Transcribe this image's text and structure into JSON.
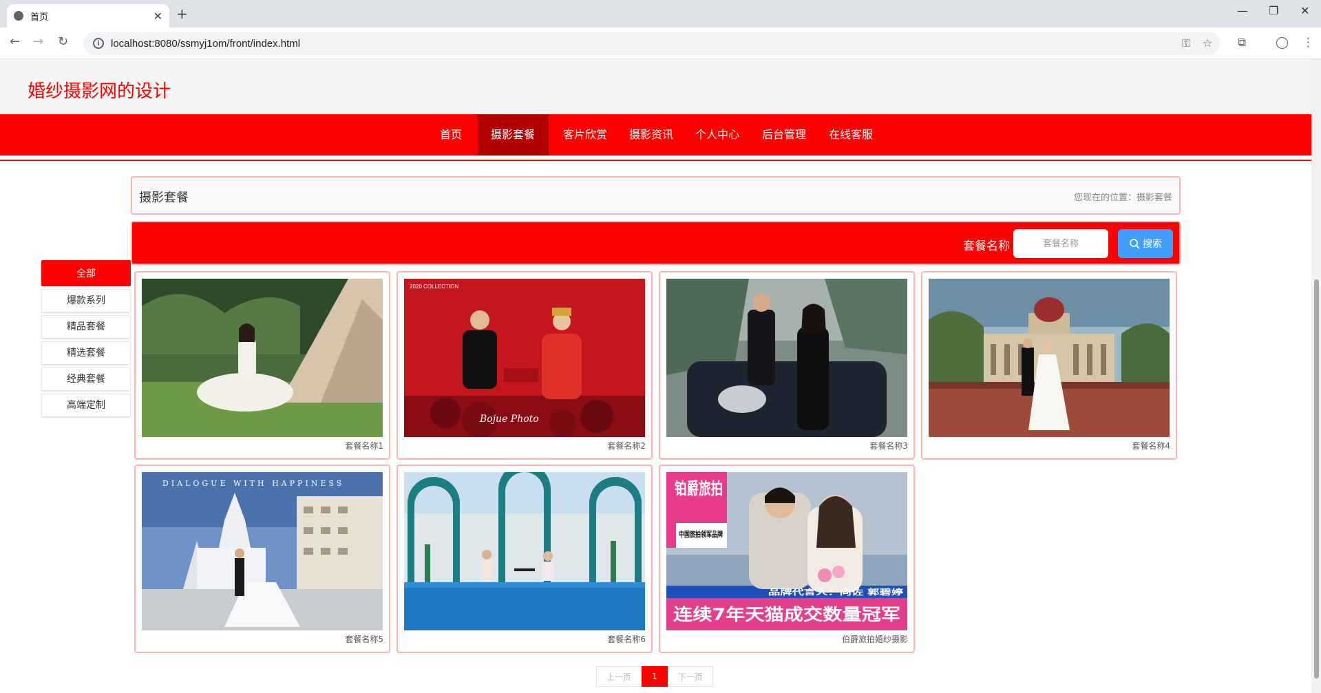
{
  "browser": {
    "tab_title": "首页",
    "url": "localhost:8080/ssmyj1om/front/index.html"
  },
  "site": {
    "title": "婚纱摄影网的设计"
  },
  "nav": {
    "items": [
      {
        "label": "首页"
      },
      {
        "label": "摄影套餐"
      },
      {
        "label": "客片欣赏"
      },
      {
        "label": "摄影资讯"
      },
      {
        "label": "个人中心"
      },
      {
        "label": "后台管理"
      },
      {
        "label": "在线客服"
      }
    ],
    "active": "摄影套餐"
  },
  "breadcrumb": {
    "heading": "摄影套餐",
    "location": "您现在的位置：摄影套餐"
  },
  "search": {
    "label": "套餐名称",
    "placeholder": "套餐名称",
    "button_label": "搜索"
  },
  "categories": {
    "items": [
      {
        "label": "全部"
      },
      {
        "label": "爆款系列"
      },
      {
        "label": "精品套餐"
      },
      {
        "label": "精选套餐"
      },
      {
        "label": "经典套餐"
      },
      {
        "label": "高端定制"
      }
    ],
    "active": "全部"
  },
  "packages": [
    {
      "name": "套餐名称1"
    },
    {
      "name": "套餐名称2",
      "photo_text": {
        "top": "2020 COLLECTION",
        "bottom": "Bojue Photo"
      }
    },
    {
      "name": "套餐名称3"
    },
    {
      "name": "套餐名称4"
    },
    {
      "name": "套餐名称5",
      "photo_text": {
        "top": "DIALOGUE WITH HAPPINESS"
      }
    },
    {
      "name": "套餐名称6"
    },
    {
      "name": "伯爵旅拍婚纱摄影",
      "photo_text": {
        "brand": "铂爵旅拍",
        "tagline": "中国旅拍领军品牌",
        "endorser": "品牌代言人：向佐 郭碧婷",
        "banner": "连续7年天猫成交数量冠军"
      }
    }
  ],
  "pager": {
    "prev": "上一页",
    "current": "1",
    "next": "下一页"
  },
  "colors": {
    "brand_red": "#ff0000",
    "nav_active": "#b20000",
    "search_button": "#409eff"
  }
}
